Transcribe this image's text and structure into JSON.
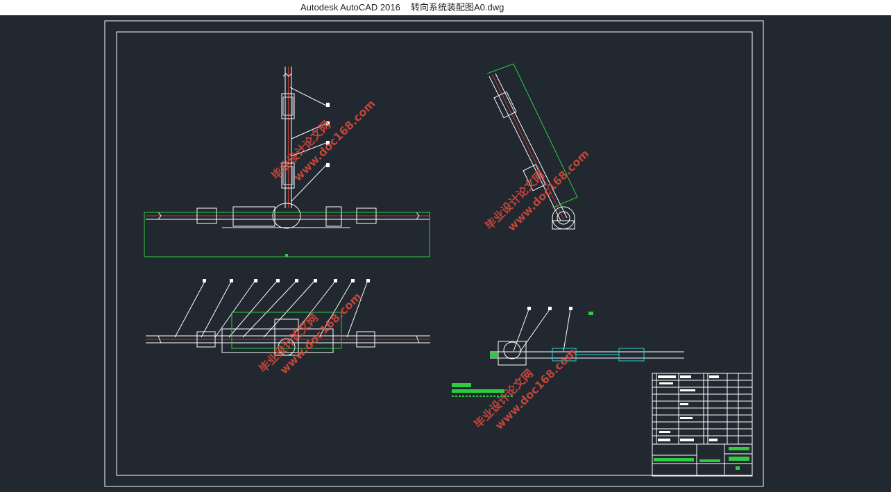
{
  "window": {
    "app_name": "Autodesk AutoCAD 2016",
    "file_name": "转向系统装配图A0.dwg"
  },
  "colors": {
    "background": "#212830",
    "titlebar": "#ffffff",
    "frame": "#ffffff",
    "part_red": "#c0392b",
    "dimension_green": "#2ecc40",
    "cyan": "#22d3d3",
    "watermark": "#e04a3c"
  },
  "drawing": {
    "watermark_text": "毕业设计论文网",
    "watermark_url": "www.doc168.com"
  }
}
